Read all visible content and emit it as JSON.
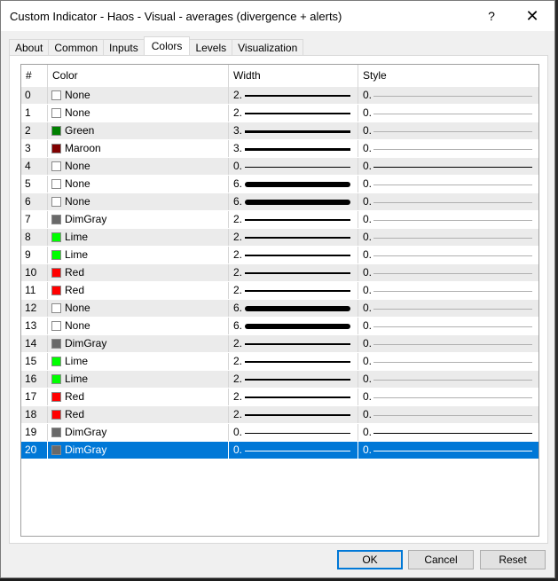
{
  "window": {
    "title": "Custom Indicator - Haos - Visual - averages (divergence + alerts)",
    "help_label": "?",
    "close_label": "✕"
  },
  "tabs": [
    {
      "label": "About",
      "active": false
    },
    {
      "label": "Common",
      "active": false
    },
    {
      "label": "Inputs",
      "active": false
    },
    {
      "label": "Colors",
      "active": true
    },
    {
      "label": "Levels",
      "active": false
    },
    {
      "label": "Visualization",
      "active": false
    }
  ],
  "table": {
    "columns": [
      "#",
      "Color",
      "Width",
      "Style"
    ],
    "rows": [
      {
        "num": "0",
        "color": "None",
        "hex": "#ffffff",
        "width": "2.",
        "thick": 2,
        "style": "0.",
        "dark": false
      },
      {
        "num": "1",
        "color": "None",
        "hex": "#ffffff",
        "width": "2.",
        "thick": 2,
        "style": "0.",
        "dark": false
      },
      {
        "num": "2",
        "color": "Green",
        "hex": "#008000",
        "width": "3.",
        "thick": 3,
        "style": "0.",
        "dark": false
      },
      {
        "num": "3",
        "color": "Maroon",
        "hex": "#800000",
        "width": "3.",
        "thick": 3,
        "style": "0.",
        "dark": false
      },
      {
        "num": "4",
        "color": "None",
        "hex": "#ffffff",
        "width": "0.",
        "thick": 1,
        "style": "0.",
        "dark": true
      },
      {
        "num": "5",
        "color": "None",
        "hex": "#ffffff",
        "width": "6.",
        "thick": 6,
        "style": "0.",
        "dark": false
      },
      {
        "num": "6",
        "color": "None",
        "hex": "#ffffff",
        "width": "6.",
        "thick": 6,
        "style": "0.",
        "dark": false
      },
      {
        "num": "7",
        "color": "DimGray",
        "hex": "#696969",
        "width": "2.",
        "thick": 2,
        "style": "0.",
        "dark": false
      },
      {
        "num": "8",
        "color": "Lime",
        "hex": "#00ff00",
        "width": "2.",
        "thick": 2,
        "style": "0.",
        "dark": false
      },
      {
        "num": "9",
        "color": "Lime",
        "hex": "#00ff00",
        "width": "2.",
        "thick": 2,
        "style": "0.",
        "dark": false
      },
      {
        "num": "10",
        "color": "Red",
        "hex": "#ff0000",
        "width": "2.",
        "thick": 2,
        "style": "0.",
        "dark": false
      },
      {
        "num": "11",
        "color": "Red",
        "hex": "#ff0000",
        "width": "2.",
        "thick": 2,
        "style": "0.",
        "dark": false
      },
      {
        "num": "12",
        "color": "None",
        "hex": "#ffffff",
        "width": "6.",
        "thick": 6,
        "style": "0.",
        "dark": false
      },
      {
        "num": "13",
        "color": "None",
        "hex": "#ffffff",
        "width": "6.",
        "thick": 6,
        "style": "0.",
        "dark": false
      },
      {
        "num": "14",
        "color": "DimGray",
        "hex": "#696969",
        "width": "2.",
        "thick": 2,
        "style": "0.",
        "dark": false
      },
      {
        "num": "15",
        "color": "Lime",
        "hex": "#00ff00",
        "width": "2.",
        "thick": 2,
        "style": "0.",
        "dark": false
      },
      {
        "num": "16",
        "color": "Lime",
        "hex": "#00ff00",
        "width": "2.",
        "thick": 2,
        "style": "0.",
        "dark": false
      },
      {
        "num": "17",
        "color": "Red",
        "hex": "#ff0000",
        "width": "2.",
        "thick": 2,
        "style": "0.",
        "dark": false
      },
      {
        "num": "18",
        "color": "Red",
        "hex": "#ff0000",
        "width": "2.",
        "thick": 2,
        "style": "0.",
        "dark": false
      },
      {
        "num": "19",
        "color": "DimGray",
        "hex": "#696969",
        "width": "0.",
        "thick": 1,
        "style": "0.",
        "dark": true
      },
      {
        "num": "20",
        "color": "DimGray",
        "hex": "#696969",
        "width": "0.",
        "thick": 1,
        "style": "0.",
        "dark": true,
        "selected": true
      }
    ]
  },
  "buttons": {
    "ok": "OK",
    "cancel": "Cancel",
    "reset": "Reset"
  },
  "colors": {
    "selection": "#0078d7",
    "row_alt": "#ebebeb"
  }
}
